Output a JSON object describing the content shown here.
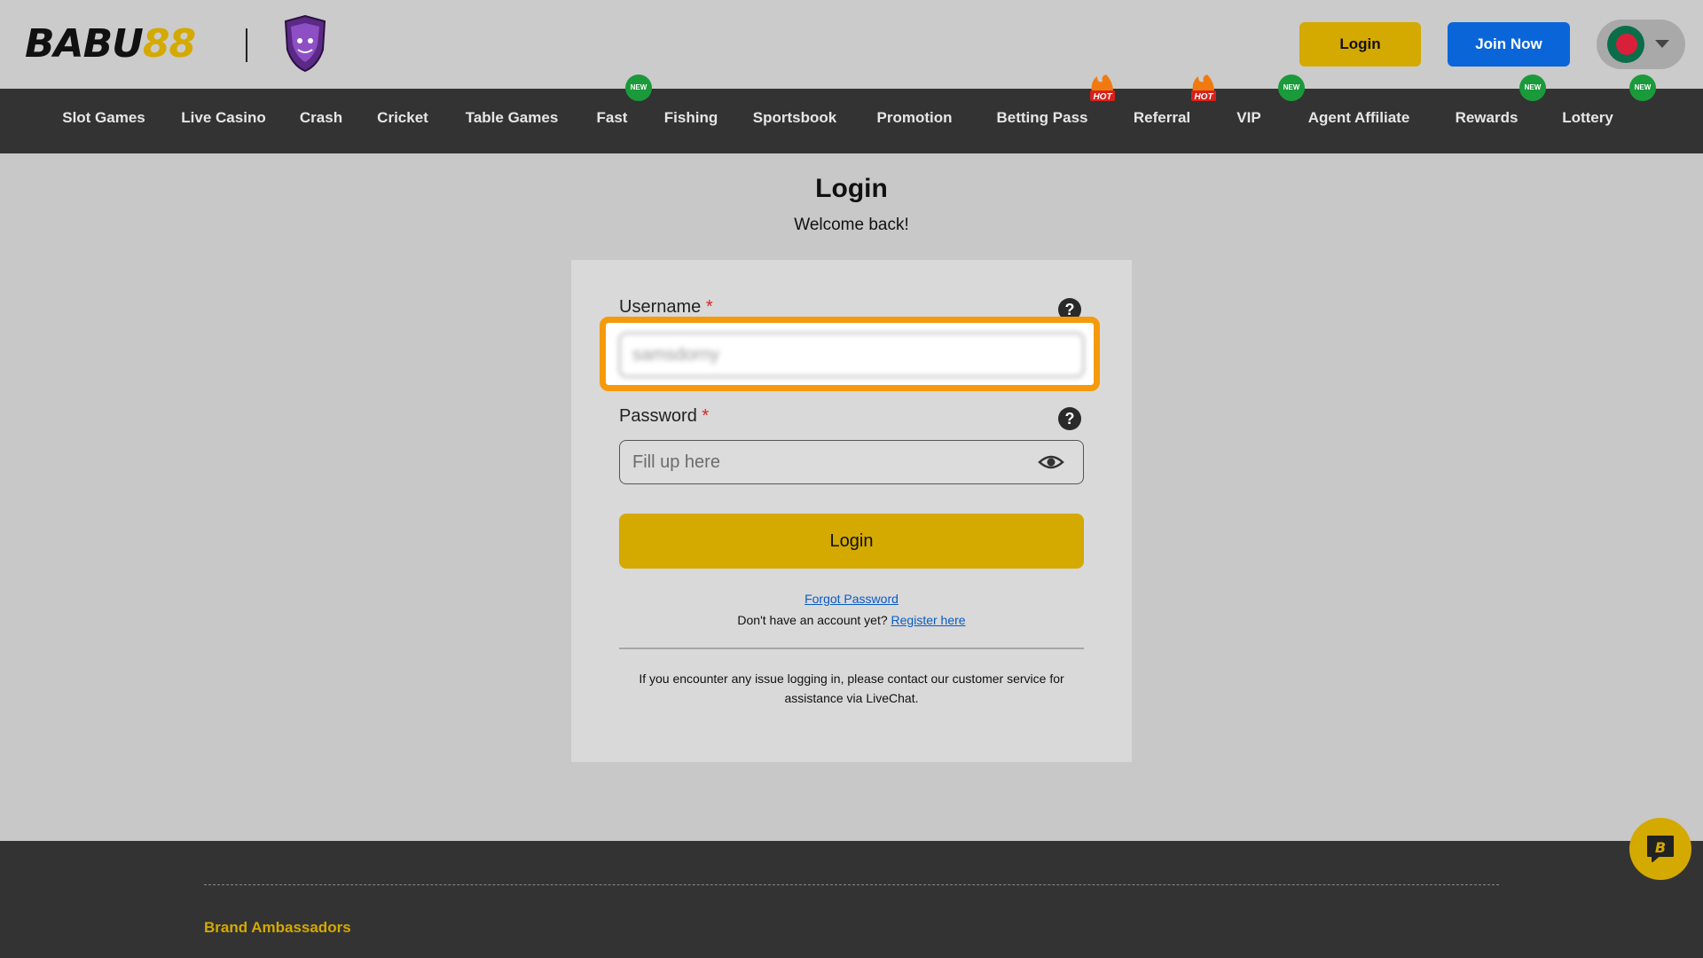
{
  "header": {
    "logo_part1": "BABU",
    "logo_part2": "88",
    "login_label": "Login",
    "join_label": "Join Now"
  },
  "nav": {
    "items": [
      {
        "label": "Slot Games"
      },
      {
        "label": "Live Casino"
      },
      {
        "label": "Crash"
      },
      {
        "label": "Cricket"
      },
      {
        "label": "Table Games"
      },
      {
        "label": "Fast",
        "badge": "NEW"
      },
      {
        "label": "Fishing"
      },
      {
        "label": "Sportsbook"
      },
      {
        "label": "Promotion"
      },
      {
        "label": "Betting Pass",
        "badge": "HOT"
      },
      {
        "label": "Referral",
        "badge": "HOT"
      },
      {
        "label": "VIP",
        "badge": "NEW"
      },
      {
        "label": "Agent Affiliate"
      },
      {
        "label": "Rewards",
        "badge": "NEW"
      },
      {
        "label": "Lottery",
        "badge": "NEW"
      }
    ]
  },
  "login": {
    "title": "Login",
    "subtitle": "Welcome back!",
    "username_label": "Username",
    "username_value": "samsdorny",
    "password_label": "Password",
    "password_placeholder": "Fill up here",
    "required_mark": "*",
    "help_glyph": "?",
    "submit_label": "Login",
    "forgot_label": "Forgot Password",
    "no_account_text": "Don't have an account yet?",
    "register_label": "Register here",
    "notice": "If you encounter any issue logging in, please contact our customer service for assistance via LiveChat."
  },
  "footer": {
    "ambassadors_label": "Brand Ambassadors"
  },
  "colors": {
    "accent": "#d4a900",
    "primary_blue": "#0a66d8",
    "nav_bg": "#333333",
    "highlight": "#f59a0c",
    "badge_new": "#1a9a3a"
  }
}
